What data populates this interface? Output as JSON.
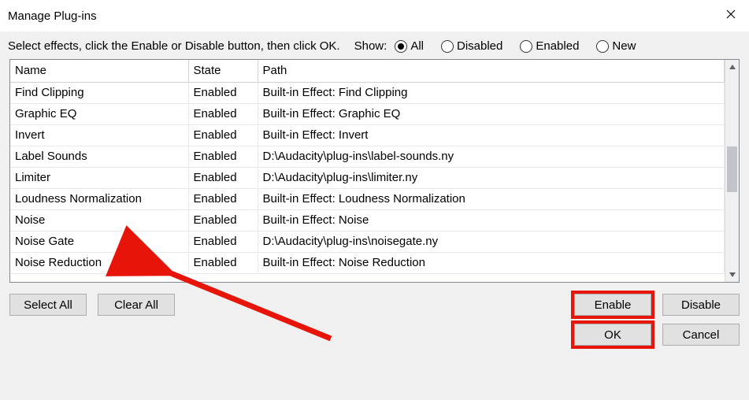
{
  "window": {
    "title": "Manage Plug-ins"
  },
  "instruction": "Select effects, click the Enable or Disable button, then click OK.",
  "show": {
    "label": "Show:",
    "options": {
      "all": "All",
      "disabled": "Disabled",
      "enabled": "Enabled",
      "new": "New"
    },
    "selected": "all"
  },
  "columns": {
    "name": "Name",
    "state": "State",
    "path": "Path"
  },
  "rows": [
    {
      "name": "Find Clipping",
      "state": "Enabled",
      "path": "Built-in Effect: Find Clipping"
    },
    {
      "name": "Graphic EQ",
      "state": "Enabled",
      "path": "Built-in Effect: Graphic EQ"
    },
    {
      "name": "Invert",
      "state": "Enabled",
      "path": "Built-in Effect: Invert"
    },
    {
      "name": "Label Sounds",
      "state": "Enabled",
      "path": "D:\\Audacity\\plug-ins\\label-sounds.ny"
    },
    {
      "name": "Limiter",
      "state": "Enabled",
      "path": "D:\\Audacity\\plug-ins\\limiter.ny"
    },
    {
      "name": "Loudness Normalization",
      "state": "Enabled",
      "path": "Built-in Effect: Loudness Normalization"
    },
    {
      "name": "Noise",
      "state": "Enabled",
      "path": "Built-in Effect: Noise"
    },
    {
      "name": "Noise Gate",
      "state": "Enabled",
      "path": "D:\\Audacity\\plug-ins\\noisegate.ny"
    },
    {
      "name": "Noise Reduction",
      "state": "Enabled",
      "path": "Built-in Effect: Noise Reduction"
    }
  ],
  "buttons": {
    "select_all": "Select All",
    "clear_all": "Clear All",
    "enable": "Enable",
    "disable": "Disable",
    "ok": "OK",
    "cancel": "Cancel"
  },
  "annotation": {
    "arrow_target_row": "Noise Gate",
    "highlighted_buttons": [
      "enable",
      "ok"
    ],
    "arrow_color": "#e7140a"
  }
}
